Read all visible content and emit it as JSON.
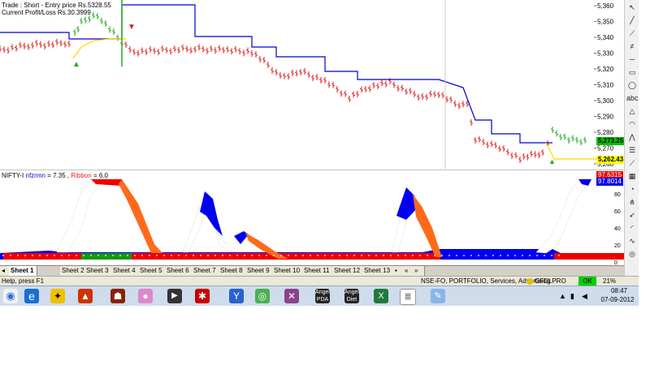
{
  "chart_header": {
    "line1": "Trade : Short - Entry price Rs.5328.55",
    "line2": "Current Profit/Loss Rs.30.3999"
  },
  "price_axis": {
    "ticks": [
      "5,360",
      "5,350",
      "5,340",
      "5,330",
      "5,320",
      "5,310",
      "5,300",
      "5,290",
      "5,280",
      "5,270",
      "5,260"
    ],
    "last_price_label": "5,273.25",
    "stop_label": "5,262.43",
    "last_price_color": "#00c000",
    "stop_color": "#ffff00"
  },
  "indicator_panel": {
    "title_prefix": "NIFTY-I",
    "series1_name": "nfzrmn",
    "series1_value": "= 7.35 ,",
    "series2_name": "Ribbon",
    "series2_value": "= 6.0",
    "value_label_red": "97.6315",
    "value_label_blue": "97.8014",
    "ticks": [
      "80",
      "60",
      "40",
      "20",
      "0"
    ]
  },
  "sheet_tabs": [
    "Sheet 1",
    "Sheet 2",
    "Sheet 3",
    "Sheet 4",
    "Sheet 5",
    "Sheet 6",
    "Sheet 7",
    "Sheet 8",
    "Sheet 9",
    "Sheet 10",
    "Sheet 11",
    "Sheet 12",
    "Sheet 13"
  ],
  "status_bar": {
    "help": "Help, press F1",
    "info": "NSE-FO, PORTFOLIO, Services, Advertising",
    "provider": "GFDLPRO",
    "ok": "OK",
    "percent": "21%"
  },
  "taskbar": {
    "time": "08:47",
    "date": "07-09-2012",
    "app_labels": [
      "Angel PDA",
      "Angel Diet"
    ]
  },
  "colors": {
    "up_bar": "#22aa22",
    "down_bar": "#dd2222",
    "stop_line": "#0000cc",
    "ribbon_red": "#ee0000",
    "ribbon_blue": "#0000ee",
    "ribbon_green": "#119911",
    "wave_orange": "#ff6a1a"
  }
}
